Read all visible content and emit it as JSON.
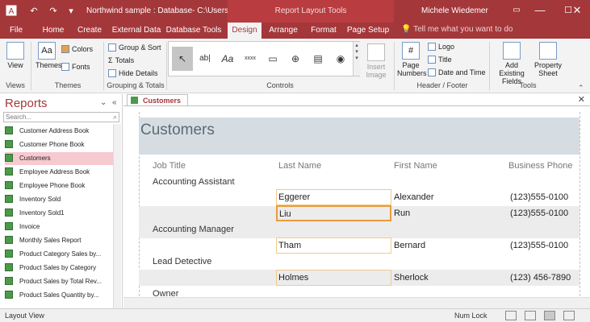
{
  "titlebar": {
    "title": "Northwind sample : Database- C:\\Users\\...",
    "context_label": "Report Layout Tools",
    "user": "Michele Wiedemer",
    "minimize_glyph": "—",
    "restore_glyph": "☐",
    "close_glyph": "✕",
    "save_glyph": "💾",
    "undo_glyph": "↶",
    "redo_glyph": "↷",
    "qat_more_glyph": "▾",
    "ribbon_opts_glyph": "▭"
  },
  "tabs": [
    {
      "label": "File"
    },
    {
      "label": "Home"
    },
    {
      "label": "Create"
    },
    {
      "label": "External Data"
    },
    {
      "label": "Database Tools"
    },
    {
      "label": "Design"
    },
    {
      "label": "Arrange"
    },
    {
      "label": "Format"
    },
    {
      "label": "Page Setup"
    }
  ],
  "tellme": "Tell me what you want to do",
  "ribbon": {
    "views": {
      "view": "View",
      "group": "Views"
    },
    "themes": {
      "themes": "Themes",
      "colors": "Colors",
      "fonts": "Fonts",
      "group": "Themes",
      "theme_glyph": "Aa"
    },
    "grouping": {
      "group_sort": "Group & Sort",
      "totals": "Totals",
      "hide_details": "Hide Details",
      "group": "Grouping & Totals",
      "sigma": "Σ"
    },
    "controls": {
      "group": "Controls",
      "insert_image": "Insert Image",
      "glyphs": [
        "↖",
        "ab|",
        "Aa",
        "xxxx",
        "▭",
        "⊕",
        "▤",
        "◉"
      ]
    },
    "header": {
      "page_numbers": "Page Numbers",
      "logo": "Logo",
      "title": "Title",
      "date_time": "Date and Time",
      "group": "Header / Footer",
      "page_num_glyph": "#"
    },
    "tools": {
      "add_fields": "Add Existing Fields",
      "property_sheet": "Property Sheet",
      "group": "Tools"
    }
  },
  "nav": {
    "heading": "Reports",
    "dropdown_glyph": "⌄",
    "collapse_glyph": "«",
    "search_placeholder": "Search...",
    "search_glyph": "⌕",
    "items": [
      {
        "label": "Customer Address Book"
      },
      {
        "label": "Customer Phone Book"
      },
      {
        "label": "Customers"
      },
      {
        "label": "Employee Address Book"
      },
      {
        "label": "Employee Phone Book"
      },
      {
        "label": "Inventory Sold"
      },
      {
        "label": "Inventory Sold1"
      },
      {
        "label": "Invoice"
      },
      {
        "label": "Monthly Sales Report"
      },
      {
        "label": "Product Category Sales by..."
      },
      {
        "label": "Product Sales by Category"
      },
      {
        "label": "Product Sales by Total Rev..."
      },
      {
        "label": "Product Sales Quantity by..."
      }
    ],
    "selected_index": 2
  },
  "document": {
    "tab_label": "Customers",
    "close_glyph": "✕",
    "report_title": "Customers",
    "headers": {
      "job_title": "Job Title",
      "last_name": "Last Name",
      "first_name": "First Name",
      "business_phone": "Business Phone"
    },
    "groups": [
      {
        "title": "Accounting Assistant",
        "rows": [
          {
            "last": "Eggerer",
            "first": "Alexander",
            "phone": "(123)555-0100"
          },
          {
            "last": "Liu",
            "first": "Run",
            "phone": "(123)555-0100"
          }
        ]
      },
      {
        "title": "Accounting Manager",
        "rows": [
          {
            "last": "Tham",
            "first": "Bernard",
            "phone": "(123)555-0100"
          }
        ]
      },
      {
        "title": "Lead Detective",
        "rows": [
          {
            "last": "Holmes",
            "first": "Sherlock",
            "phone": "(123) 456-7890"
          }
        ]
      },
      {
        "title": "Owner",
        "rows": []
      }
    ]
  },
  "statusbar": {
    "left": "Layout View",
    "numlock": "Num Lock"
  },
  "colors": {
    "accent": "#a4373a",
    "band": "#d6dde2",
    "selection": "#e89e3c"
  }
}
